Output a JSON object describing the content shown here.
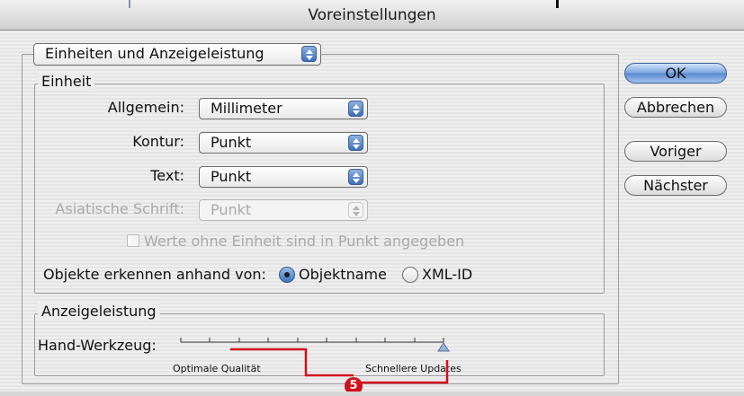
{
  "window": {
    "title": "Voreinstellungen"
  },
  "panel_select": {
    "value": "Einheiten und Anzeigeleistung"
  },
  "buttons": {
    "ok": "OK",
    "cancel": "Abbrechen",
    "prev": "Voriger",
    "next": "Nächster"
  },
  "einheit": {
    "group_label": "Einheit",
    "rows": [
      {
        "label": "Allgemein:",
        "value": "Millimeter",
        "enabled": true
      },
      {
        "label": "Kontur:",
        "value": "Punkt",
        "enabled": true
      },
      {
        "label": "Text:",
        "value": "Punkt",
        "enabled": true
      },
      {
        "label": "Asiatische Schrift:",
        "value": "Punkt",
        "enabled": false
      }
    ],
    "checkbox_label": "Werte ohne Einheit sind in Punkt angegeben",
    "checkbox_checked": false,
    "objects_label": "Objekte erkennen anhand von:",
    "radio_options": [
      "Objektname",
      "XML-ID"
    ],
    "radio_selected": "Objektname"
  },
  "anzeige": {
    "group_label": "Anzeigeleistung",
    "slider_label": "Hand-Werkzeug:",
    "slider_min_label": "Optimale Qualität",
    "slider_max_label": "Schnellere Updates",
    "slider_value_fraction": 1.0
  },
  "annotation": {
    "number": "5",
    "color": "#d1101e"
  },
  "colors": {
    "accent": "#5b8ad0",
    "annotation": "#d1101e"
  }
}
